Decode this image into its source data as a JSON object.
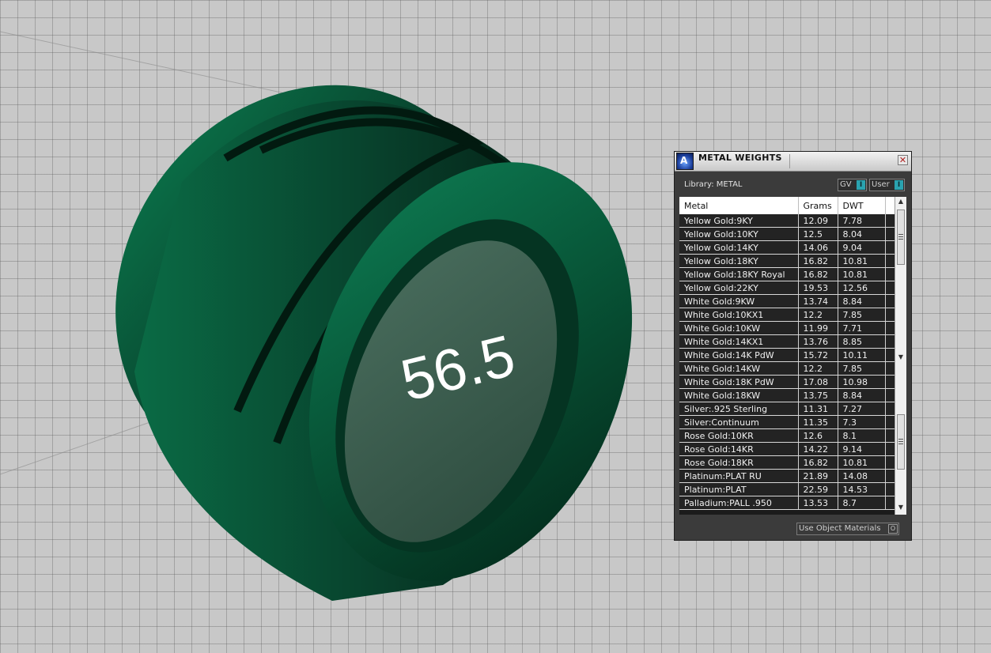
{
  "viewport": {
    "ring_label": "56.5",
    "ring_color": "#0b6a47",
    "grid_color": "#c8c8c8"
  },
  "panel": {
    "title": "METAL WEIGHTS",
    "close_icon": "close-icon",
    "library_label": "Library: METAL",
    "gv_label": "GV",
    "user_label": "User",
    "toggle_knob": "I",
    "use_object_materials_label": "Use Object Materials",
    "use_object_materials_knob": "O",
    "columns": [
      "Metal",
      "Grams",
      "DWT"
    ],
    "rows": [
      [
        "Yellow Gold:9KY",
        "12.09",
        "7.78"
      ],
      [
        "Yellow Gold:10KY",
        "12.5",
        "8.04"
      ],
      [
        "Yellow Gold:14KY",
        "14.06",
        "9.04"
      ],
      [
        "Yellow Gold:18KY",
        "16.82",
        "10.81"
      ],
      [
        "Yellow Gold:18KY Royal",
        "16.82",
        "10.81"
      ],
      [
        "Yellow Gold:22KY",
        "19.53",
        "12.56"
      ],
      [
        "White Gold:9KW",
        "13.74",
        "8.84"
      ],
      [
        "White Gold:10KX1",
        "12.2",
        "7.85"
      ],
      [
        "White Gold:10KW",
        "11.99",
        "7.71"
      ],
      [
        "White Gold:14KX1",
        "13.76",
        "8.85"
      ],
      [
        "White Gold:14K PdW",
        "15.72",
        "10.11"
      ],
      [
        "White Gold:14KW",
        "12.2",
        "7.85"
      ],
      [
        "White Gold:18K PdW",
        "17.08",
        "10.98"
      ],
      [
        "White Gold:18KW",
        "13.75",
        "8.84"
      ],
      [
        "Silver:.925 Sterling",
        "11.31",
        "7.27"
      ],
      [
        "Silver:Continuum",
        "11.35",
        "7.3"
      ],
      [
        "Rose Gold:10KR",
        "12.6",
        "8.1"
      ],
      [
        "Rose Gold:14KR",
        "14.22",
        "9.14"
      ],
      [
        "Rose Gold:18KR",
        "16.82",
        "10.81"
      ],
      [
        "Platinum:PLAT RU",
        "21.89",
        "14.08"
      ],
      [
        "Platinum:PLAT",
        "22.59",
        "14.53"
      ],
      [
        "Palladium:PALL .950",
        "13.53",
        "8.7"
      ]
    ],
    "scroll_up_icon": "▲",
    "scroll_down_icon": "▼"
  }
}
